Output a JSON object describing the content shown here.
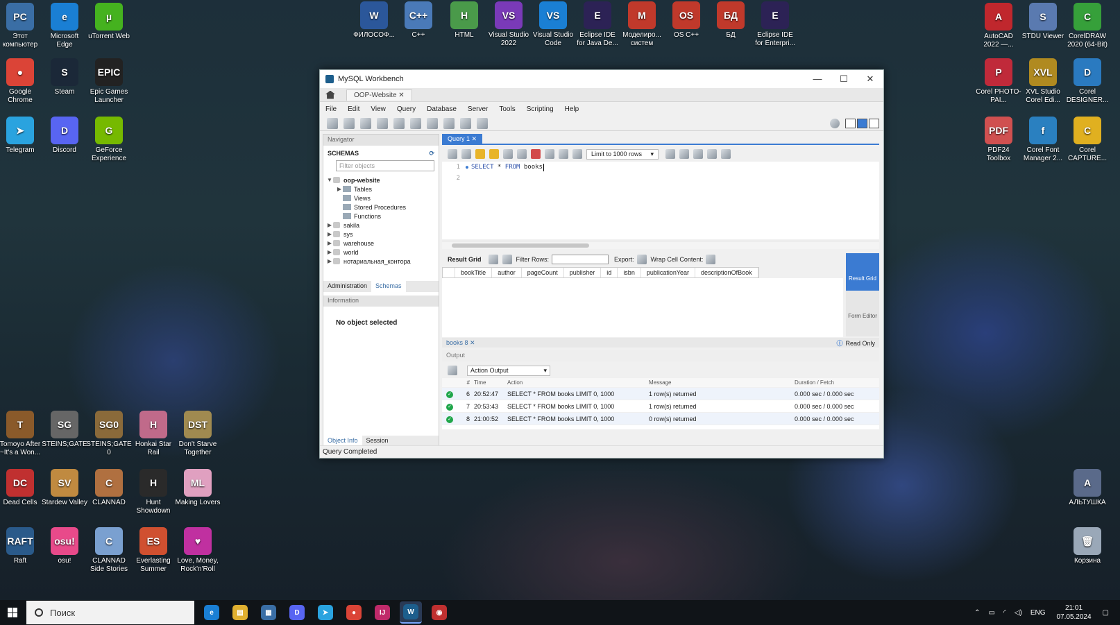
{
  "desktop": {
    "left_icons": [
      {
        "label": "Этот компьютер",
        "color": "#3a6ea5",
        "glyph": "PC"
      },
      {
        "label": "Microsoft Edge",
        "color": "#1a7fd4",
        "glyph": "e"
      },
      {
        "label": "uTorrent Web",
        "color": "#45b21f",
        "glyph": "µ"
      },
      {
        "label": "Google Chrome",
        "color": "#db4437",
        "glyph": "●"
      },
      {
        "label": "Steam",
        "color": "#1b2838",
        "glyph": "S"
      },
      {
        "label": "Epic Games Launcher",
        "color": "#222222",
        "glyph": "EPIC"
      },
      {
        "label": "Telegram",
        "color": "#2aa3df",
        "glyph": "➤"
      },
      {
        "label": "Discord",
        "color": "#5865f2",
        "glyph": "D"
      },
      {
        "label": "GeForce Experience",
        "color": "#76b900",
        "glyph": "G"
      }
    ],
    "bottom_icons": [
      {
        "label": "Tomoyo After ~It's a Won...",
        "color": "#8a5a2a",
        "glyph": "T"
      },
      {
        "label": "STEINS;GATE",
        "color": "#666666",
        "glyph": "SG"
      },
      {
        "label": "STEINS;GATE 0",
        "color": "#8a6a3a",
        "glyph": "SG0"
      },
      {
        "label": "Honkai Star Rail",
        "color": "#c06a8a",
        "glyph": "H"
      },
      {
        "label": "Don't Starve Together",
        "color": "#a08a50",
        "glyph": "DST"
      },
      {
        "label": "Dead Cells",
        "color": "#c03030",
        "glyph": "DC"
      },
      {
        "label": "Stardew Valley",
        "color": "#c08a40",
        "glyph": "SV"
      },
      {
        "label": "CLANNAD",
        "color": "#b07040",
        "glyph": "C"
      },
      {
        "label": "Hunt Showdown",
        "color": "#2a2a2a",
        "glyph": "H"
      },
      {
        "label": "Making Lovers",
        "color": "#e0a0c0",
        "glyph": "ML"
      },
      {
        "label": "Raft",
        "color": "#2a5a8a",
        "glyph": "RAFT"
      },
      {
        "label": "osu!",
        "color": "#e84a8a",
        "glyph": "osu!"
      },
      {
        "label": "CLANNAD Side Stories",
        "color": "#7aa0d0",
        "glyph": "C"
      },
      {
        "label": "Everlasting Summer",
        "color": "#d05030",
        "glyph": "ES"
      },
      {
        "label": "Love, Money, Rock'n'Roll",
        "color": "#c030a0",
        "glyph": "♥"
      }
    ],
    "top_icons": [
      {
        "label": "ФИЛОСОФ...",
        "color": "#2b579a",
        "glyph": "W"
      },
      {
        "label": "C++",
        "color": "#4a7ab8",
        "glyph": "C++"
      },
      {
        "label": "HTML",
        "color": "#4a9a4a",
        "glyph": "H"
      },
      {
        "label": "Visual Studio 2022",
        "color": "#7a3ab8",
        "glyph": "VS"
      },
      {
        "label": "Visual Studio Code",
        "color": "#1a7fd4",
        "glyph": "VS"
      },
      {
        "label": "Eclipse IDE for Java De...",
        "color": "#2c2255",
        "glyph": "E"
      },
      {
        "label": "Моделиро... систем",
        "color": "#c0392b",
        "glyph": "M"
      },
      {
        "label": "OS C++",
        "color": "#c0392b",
        "glyph": "OS"
      },
      {
        "label": "БД",
        "color": "#c0392b",
        "glyph": "БД"
      },
      {
        "label": "Eclipse IDE for Enterpri...",
        "color": "#2c2255",
        "glyph": "E"
      }
    ],
    "right_icons": [
      {
        "label": "AutoCAD 2022 —...",
        "color": "#c0272d",
        "glyph": "A"
      },
      {
        "label": "STDU Viewer",
        "color": "#5a7ab0",
        "glyph": "S"
      },
      {
        "label": "CorelDRAW 2020 (64-Bit)",
        "color": "#36a03a",
        "glyph": "C"
      },
      {
        "label": "Corel PHOTO-PAI...",
        "color": "#c02a3a",
        "glyph": "P"
      },
      {
        "label": "XVL Studio Corel Edi...",
        "color": "#b08a20",
        "glyph": "XVL"
      },
      {
        "label": "Corel DESIGNER...",
        "color": "#2a7ac0",
        "glyph": "D"
      },
      {
        "label": "PDF24 Toolbox",
        "color": "#d05050",
        "glyph": "PDF"
      },
      {
        "label": "Corel Font Manager 2...",
        "color": "#2a80c0",
        "glyph": "f"
      },
      {
        "label": "Corel CAPTURE...",
        "color": "#e0b020",
        "glyph": "C"
      },
      {
        "label": "АЛЬТУШКА",
        "color": "#5a6a8a",
        "glyph": "А"
      },
      {
        "label": "Корзина",
        "color": "#9aa8b8",
        "glyph": "🗑"
      }
    ]
  },
  "window": {
    "title": "MySQL Workbench",
    "connection_tab": "OOP-Website",
    "menu": [
      "File",
      "Edit",
      "View",
      "Query",
      "Database",
      "Server",
      "Tools",
      "Scripting",
      "Help"
    ],
    "navigator": {
      "header": "Navigator",
      "schemas_label": "SCHEMAS",
      "filter_placeholder": "Filter objects",
      "schemas": [
        {
          "name": "oop-website",
          "expanded": true,
          "children": [
            "Tables",
            "Views",
            "Stored Procedures",
            "Functions"
          ]
        },
        {
          "name": "sakila"
        },
        {
          "name": "sys"
        },
        {
          "name": "warehouse"
        },
        {
          "name": "world"
        },
        {
          "name": "нотариальная_контора"
        }
      ],
      "tabs": [
        "Administration",
        "Schemas"
      ],
      "info_header": "Information",
      "no_object": "No object selected",
      "bottom_tabs": [
        "Object Info",
        "Session"
      ]
    },
    "query_tab": "Query 1",
    "limit_label": "Limit to 1000 rows",
    "editor_lines": [
      {
        "num": "1",
        "sql_kw1": "SELECT",
        "sql_mid": " * ",
        "sql_kw2": "FROM",
        "sql_tail": " books"
      },
      {
        "num": "2"
      }
    ],
    "result": {
      "grid_label": "Result Grid",
      "filter_label": "Filter Rows:",
      "export_label": "Export:",
      "wrap_label": "Wrap Cell Content:",
      "columns": [
        "bookTitle",
        "author",
        "pageCount",
        "publisher",
        "id",
        "isbn",
        "publicationYear",
        "descriptionOfBook"
      ],
      "side_buttons": [
        "Result Grid",
        "Form Editor"
      ],
      "tab_label": "books 8",
      "read_only": "Read Only"
    },
    "output": {
      "header": "Output",
      "selector": "Action Output",
      "columns": [
        "#",
        "Time",
        "Action",
        "Message",
        "Duration / Fetch"
      ],
      "rows": [
        {
          "n": "6",
          "time": "20:52:47",
          "action": "SELECT * FROM books LIMIT 0, 1000",
          "message": "1 row(s) returned",
          "duration": "0.000 sec / 0.000 sec"
        },
        {
          "n": "7",
          "time": "20:53:43",
          "action": "SELECT * FROM books LIMIT 0, 1000",
          "message": "1 row(s) returned",
          "duration": "0.000 sec / 0.000 sec"
        },
        {
          "n": "8",
          "time": "21:00:52",
          "action": "SELECT * FROM books LIMIT 0, 1000",
          "message": "0 row(s) returned",
          "duration": "0.000 sec / 0.000 sec"
        }
      ]
    },
    "status": "Query Completed"
  },
  "taskbar": {
    "search_placeholder": "Поиск",
    "apps": [
      {
        "name": "edge",
        "color": "#1a7fd4",
        "glyph": "e"
      },
      {
        "name": "explorer",
        "color": "#e0b030",
        "glyph": "▤"
      },
      {
        "name": "store",
        "color": "#3a6ea5",
        "glyph": "▦"
      },
      {
        "name": "discord",
        "color": "#5865f2",
        "glyph": "D"
      },
      {
        "name": "telegram",
        "color": "#2aa3df",
        "glyph": "➤"
      },
      {
        "name": "chrome",
        "color": "#db4437",
        "glyph": "●"
      },
      {
        "name": "intellij",
        "color": "#c02a6a",
        "glyph": "IJ"
      },
      {
        "name": "mysql-workbench",
        "color": "#1d5e8c",
        "glyph": "W"
      },
      {
        "name": "recorder",
        "color": "#c03030",
        "glyph": "◉"
      }
    ],
    "lang": "ENG",
    "time": "21:01",
    "date": "07.05.2024"
  }
}
